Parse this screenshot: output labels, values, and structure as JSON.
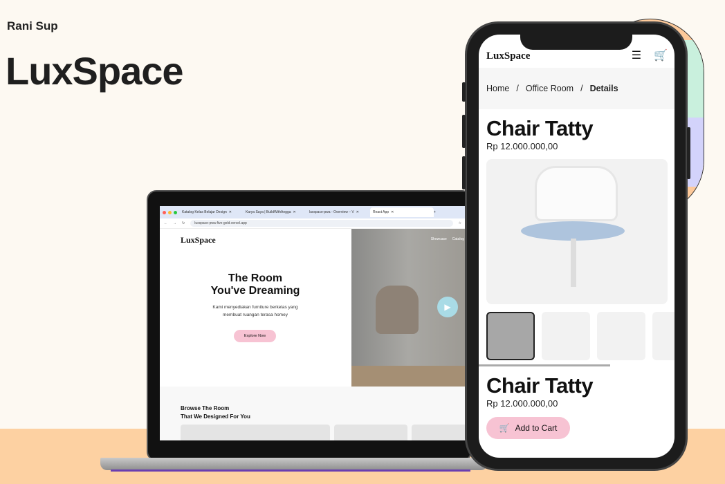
{
  "author": "Rani Sup",
  "brand": "LuxSpace",
  "browser": {
    "tabs": [
      {
        "label": "Katalog Kelas Belajar Design"
      },
      {
        "label": "Karya Saya | BuildWithAngga"
      },
      {
        "label": "luxspace-pwa - Overview – V"
      },
      {
        "label": "React App"
      }
    ],
    "url": "luxspace-pwa-five-gold.vercel.app"
  },
  "site": {
    "logo": "LuxSpace",
    "nav": [
      "Showcase",
      "Catalog"
    ],
    "hero_title_1": "The Room",
    "hero_title_2": "You've Dreaming",
    "hero_desc_1": "Kami menyediakan furniture berkelas yang",
    "hero_desc_2": "membuat ruangan terasa homey",
    "cta": "Explore Now",
    "browse_1": "Browse The Room",
    "browse_2": "That We Designed For You"
  },
  "phone": {
    "logo": "LuxSpace",
    "breadcrumb": [
      "Home",
      "Office Room",
      "Details"
    ],
    "product_name": "Chair Tatty",
    "price": "Rp 12.000.000,00",
    "add_to_cart": "Add to Cart"
  },
  "colors": {
    "accent_pink": "#f7c3d3",
    "floor": "#fdd1a2",
    "background": "#fdf9f2"
  }
}
